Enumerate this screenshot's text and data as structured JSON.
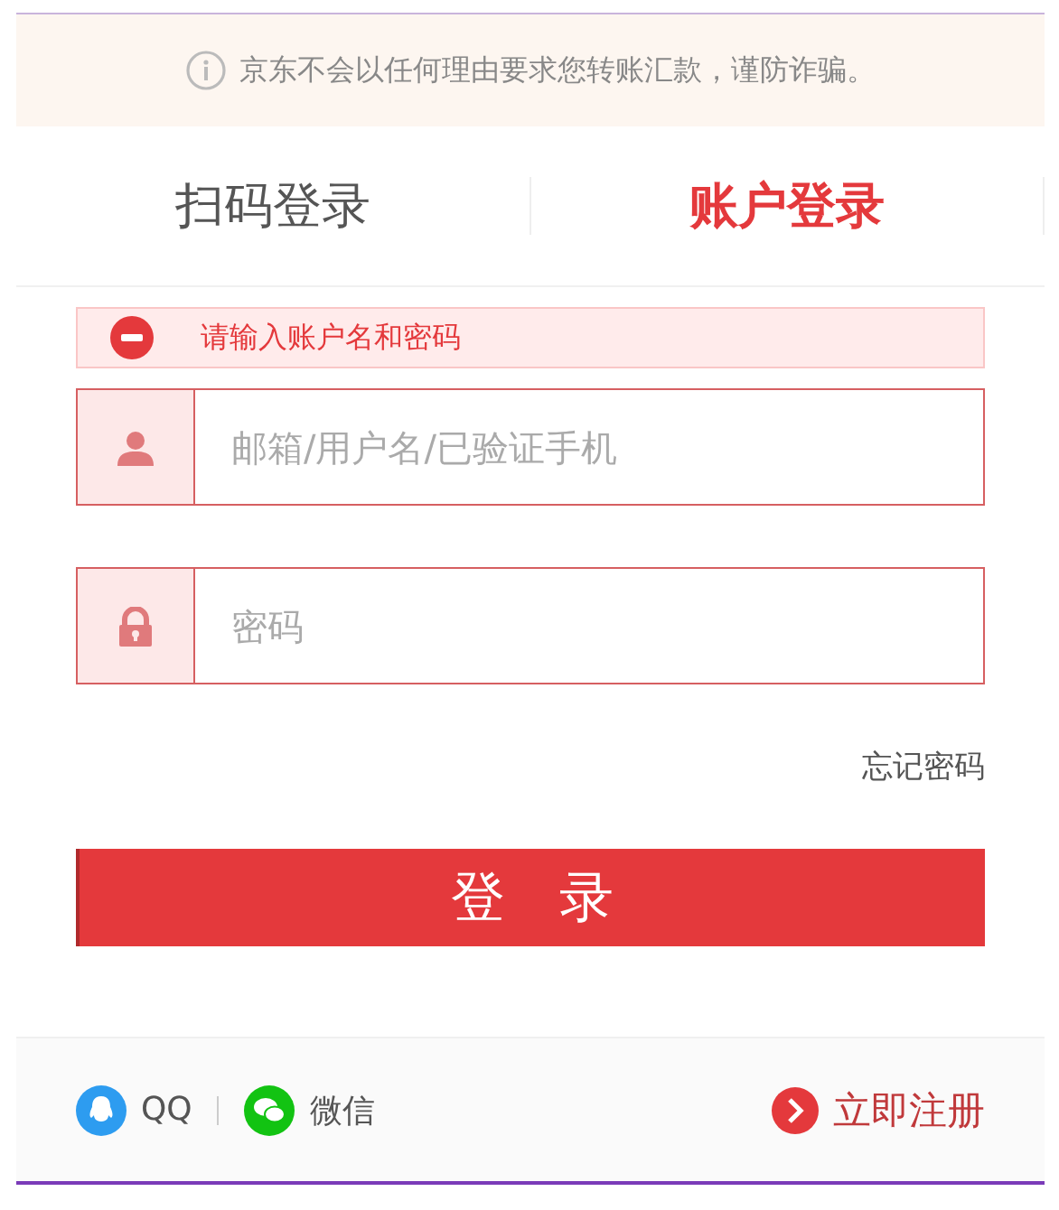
{
  "notice": {
    "text": "京东不会以任何理由要求您转账汇款，谨防诈骗。"
  },
  "tabs": [
    {
      "label": "扫码登录",
      "selected": false
    },
    {
      "label": "账户登录",
      "selected": true
    }
  ],
  "error": {
    "text": "请输入账户名和密码"
  },
  "fields": [
    {
      "kind": "user",
      "placeholder": "邮箱/用户名/已验证手机"
    },
    {
      "kind": "password",
      "placeholder": "密码"
    }
  ],
  "forgot_link": "忘记密码",
  "login_button": "登　录",
  "footer": {
    "social": [
      {
        "kind": "qq",
        "label": "QQ"
      },
      {
        "kind": "wechat",
        "label": "微信"
      }
    ],
    "register": "立即注册"
  }
}
